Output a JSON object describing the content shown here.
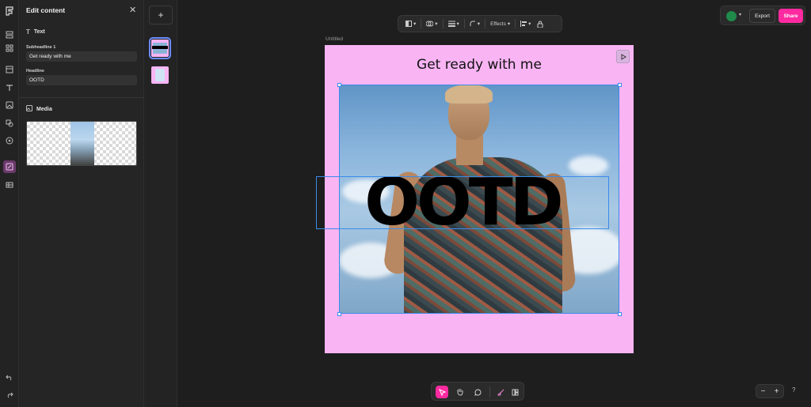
{
  "panel": {
    "title": "Edit content",
    "text_section": "Text",
    "fields": [
      {
        "label": "Subheadline 1",
        "value": "Get ready with me"
      },
      {
        "label": "Headline",
        "value": "OOTD"
      }
    ],
    "media_section": "Media"
  },
  "pages": {
    "add_label": "+"
  },
  "toolbar": {
    "effects_label": "Effects"
  },
  "document": {
    "name": "Untitled"
  },
  "header": {
    "export_label": "Export",
    "share_label": "Share"
  },
  "canvas": {
    "title": "Get ready with me",
    "headline": "OOTD",
    "background_color": "#f8b4f3"
  },
  "zoom": {
    "minus": "−",
    "plus": "+"
  },
  "help": {
    "label": "?"
  },
  "colors": {
    "accent": "#ff2aa0",
    "selection": "#3b8bea"
  }
}
